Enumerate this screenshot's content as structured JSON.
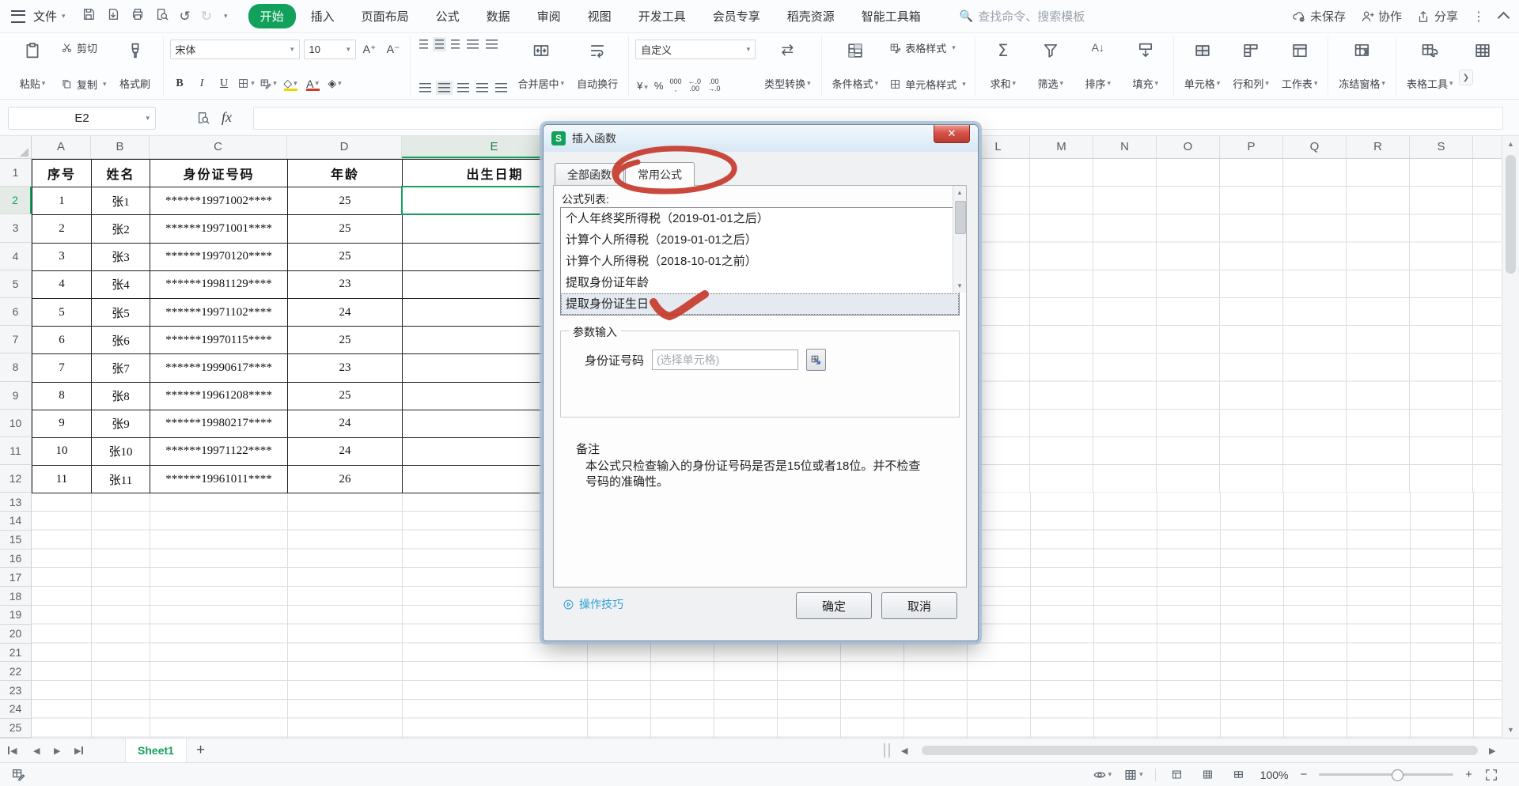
{
  "menubar": {
    "file": "文件",
    "tabs": [
      "开始",
      "插入",
      "页面布局",
      "公式",
      "数据",
      "审阅",
      "视图",
      "开发工具",
      "会员专享",
      "稻壳资源",
      "智能工具箱"
    ],
    "active_tab": "开始",
    "search_placeholder": "查找命令、搜索模板",
    "unsaved": "未保存",
    "collaborate": "协作",
    "share": "分享"
  },
  "ribbon": {
    "paste": "粘贴",
    "cut": "剪切",
    "copy": "复制",
    "format_painter": "格式刷",
    "font_name": "宋体",
    "font_size": "10",
    "merge_center": "合并居中",
    "wrap_text": "自动换行",
    "number_format": "自定义",
    "type_convert": "类型转换",
    "cond_format": "条件格式",
    "table_style": "表格样式",
    "cell_style": "单元格样式",
    "sum": "求和",
    "filter": "筛选",
    "sort": "排序",
    "fill": "填充",
    "cells": "单元格",
    "rows_cols": "行和列",
    "worksheet": "工作表",
    "freeze": "冻结窗格",
    "table_tools": "表格工具"
  },
  "formula_bar": {
    "cell_ref": "E2",
    "fx": "fx"
  },
  "sheet": {
    "col_letters_left": [
      "A",
      "B",
      "C",
      "D",
      "E"
    ],
    "col_letters_right": [
      "L",
      "M",
      "N",
      "O",
      "P",
      "Q",
      "R",
      "S"
    ],
    "selected_column": "E",
    "selected_row": 2,
    "row_count": 25,
    "table_headers": [
      "序号",
      "姓名",
      "身份证号码",
      "年龄",
      "出生日期"
    ],
    "rows": [
      [
        "1",
        "张1",
        "******19971002****",
        "25"
      ],
      [
        "2",
        "张2",
        "******19971001****",
        "25"
      ],
      [
        "3",
        "张3",
        "******19970120****",
        "25"
      ],
      [
        "4",
        "张4",
        "******19981129****",
        "23"
      ],
      [
        "5",
        "张5",
        "******19971102****",
        "24"
      ],
      [
        "6",
        "张6",
        "******19970115****",
        "25"
      ],
      [
        "7",
        "张7",
        "******19990617****",
        "23"
      ],
      [
        "8",
        "张8",
        "******19961208****",
        "25"
      ],
      [
        "9",
        "张9",
        "******19980217****",
        "24"
      ],
      [
        "10",
        "张10",
        "******19971122****",
        "24"
      ],
      [
        "11",
        "张11",
        "******19961011****",
        "26"
      ]
    ]
  },
  "dialog": {
    "title": "插入函数",
    "tabs": [
      "全部函数",
      "常用公式"
    ],
    "active_tab": "常用公式",
    "list_label": "公式列表:",
    "formulas": [
      "个人年终奖所得税（2019-01-01之后）",
      "计算个人所得税（2019-01-01之后）",
      "计算个人所得税（2018-10-01之前）",
      "提取身份证年龄",
      "提取身份证生日"
    ],
    "selected_formula": "提取身份证生日",
    "param_group": "参数输入",
    "param_label": "身份证号码",
    "param_placeholder": "(选择单元格)",
    "note_title": "备注",
    "note_line1": "本公式只检查输入的身份证号码是否是15位或者18位。并不检查",
    "note_line2": "号码的准确性。",
    "tips_link": "操作技巧",
    "ok": "确定",
    "cancel": "取消"
  },
  "tabbar": {
    "sheet": "Sheet1"
  },
  "statusbar": {
    "zoom": "100%"
  },
  "colors": {
    "accent_green": "#12a15b",
    "annotation_red": "#c5392b",
    "selection_green": "#17a05d"
  }
}
